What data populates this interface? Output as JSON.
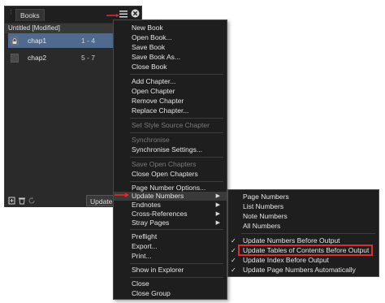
{
  "panel": {
    "tab_label": "Books",
    "doc_title": "Untitled [Modified]",
    "chapters": [
      {
        "name": "chap1",
        "pages": "1 - 4",
        "selected": true
      },
      {
        "name": "chap2",
        "pages": "5 - 7",
        "selected": false
      }
    ],
    "update_button": "Update N"
  },
  "menu": {
    "items": [
      {
        "label": "New Book"
      },
      {
        "label": "Open Book..."
      },
      {
        "label": "Save Book"
      },
      {
        "label": "Save Book As..."
      },
      {
        "label": "Close Book"
      },
      {
        "label": "Add Chapter..."
      },
      {
        "label": "Open Chapter"
      },
      {
        "label": "Remove Chapter"
      },
      {
        "label": "Replace Chapter..."
      },
      {
        "label": "Set Style Source Chapter"
      },
      {
        "label": "Synchronise"
      },
      {
        "label": "Synchronise Settings..."
      },
      {
        "label": "Save Open Chapters"
      },
      {
        "label": "Close Open Chapters"
      },
      {
        "label": "Page Number Options..."
      },
      {
        "label": "Update Numbers"
      },
      {
        "label": "Endnotes"
      },
      {
        "label": "Cross-References"
      },
      {
        "label": "Stray Pages"
      },
      {
        "label": "Preflight"
      },
      {
        "label": "Export..."
      },
      {
        "label": "Print..."
      },
      {
        "label": "Show in Explorer"
      },
      {
        "label": "Close"
      },
      {
        "label": "Close Group"
      }
    ]
  },
  "submenu": {
    "items": [
      {
        "label": "Page Numbers"
      },
      {
        "label": "List Numbers"
      },
      {
        "label": "Note Numbers"
      },
      {
        "label": "All Numbers"
      },
      {
        "label": "Update Numbers Before Output"
      },
      {
        "label": "Update Tables of Contents Before Output"
      },
      {
        "label": "Update Index Before Output"
      },
      {
        "label": "Update Page Numbers Automatically"
      }
    ]
  },
  "colors": {
    "panel_bg": "#2a2a2a",
    "menu_bg": "#1e1e1e",
    "selection": "#4e6b8f",
    "annotation_red": "#e02b2b"
  }
}
